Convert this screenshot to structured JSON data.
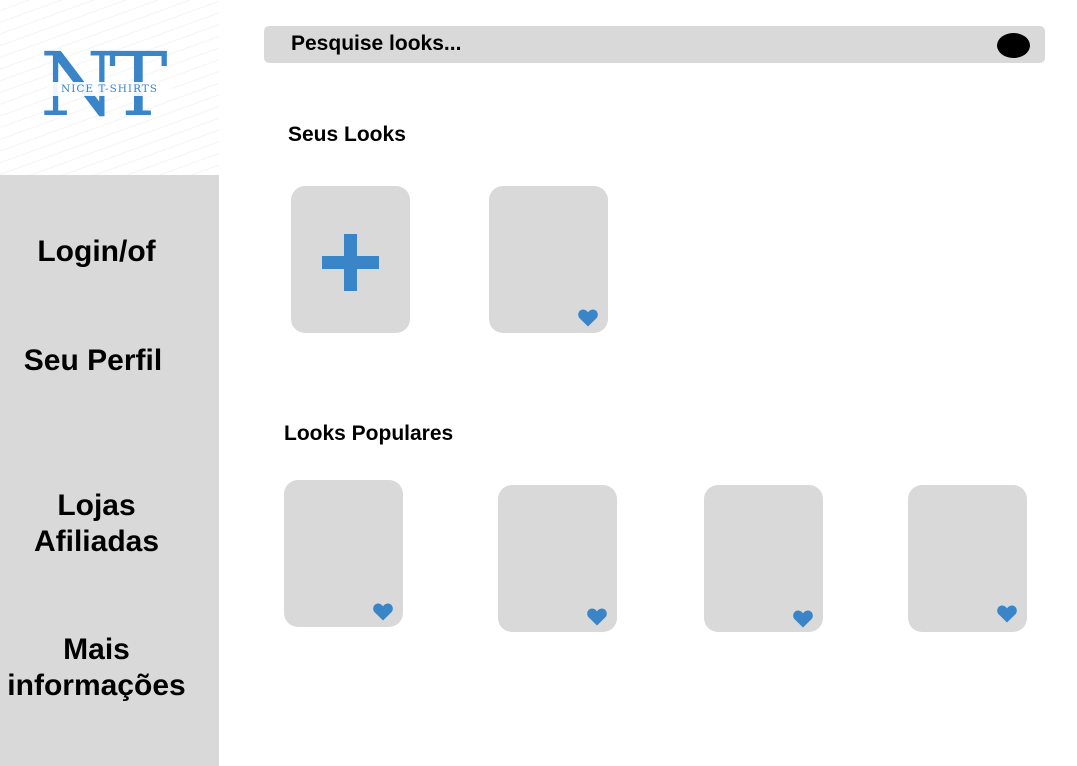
{
  "brand": {
    "logo_letters": "NT",
    "tagline": "NICE T-SHIRTS",
    "accent_color": "#3a84c8"
  },
  "sidebar": {
    "items": [
      {
        "label": "Login/of"
      },
      {
        "label": "Seu Perfil"
      },
      {
        "label": "Lojas\nAfiliadas"
      },
      {
        "label": "Mais\ninformações"
      }
    ]
  },
  "search": {
    "placeholder": "Pesquise looks...",
    "value": "",
    "icon": "search-icon"
  },
  "my_looks": {
    "title": "Seus Looks",
    "add_icon": "plus-icon",
    "cards": [
      {
        "icon": "heart-icon"
      }
    ]
  },
  "popular_looks": {
    "title": "Looks Populares",
    "cards": [
      {
        "icon": "heart-icon"
      },
      {
        "icon": "heart-icon"
      },
      {
        "icon": "heart-icon"
      },
      {
        "icon": "heart-icon"
      }
    ]
  }
}
